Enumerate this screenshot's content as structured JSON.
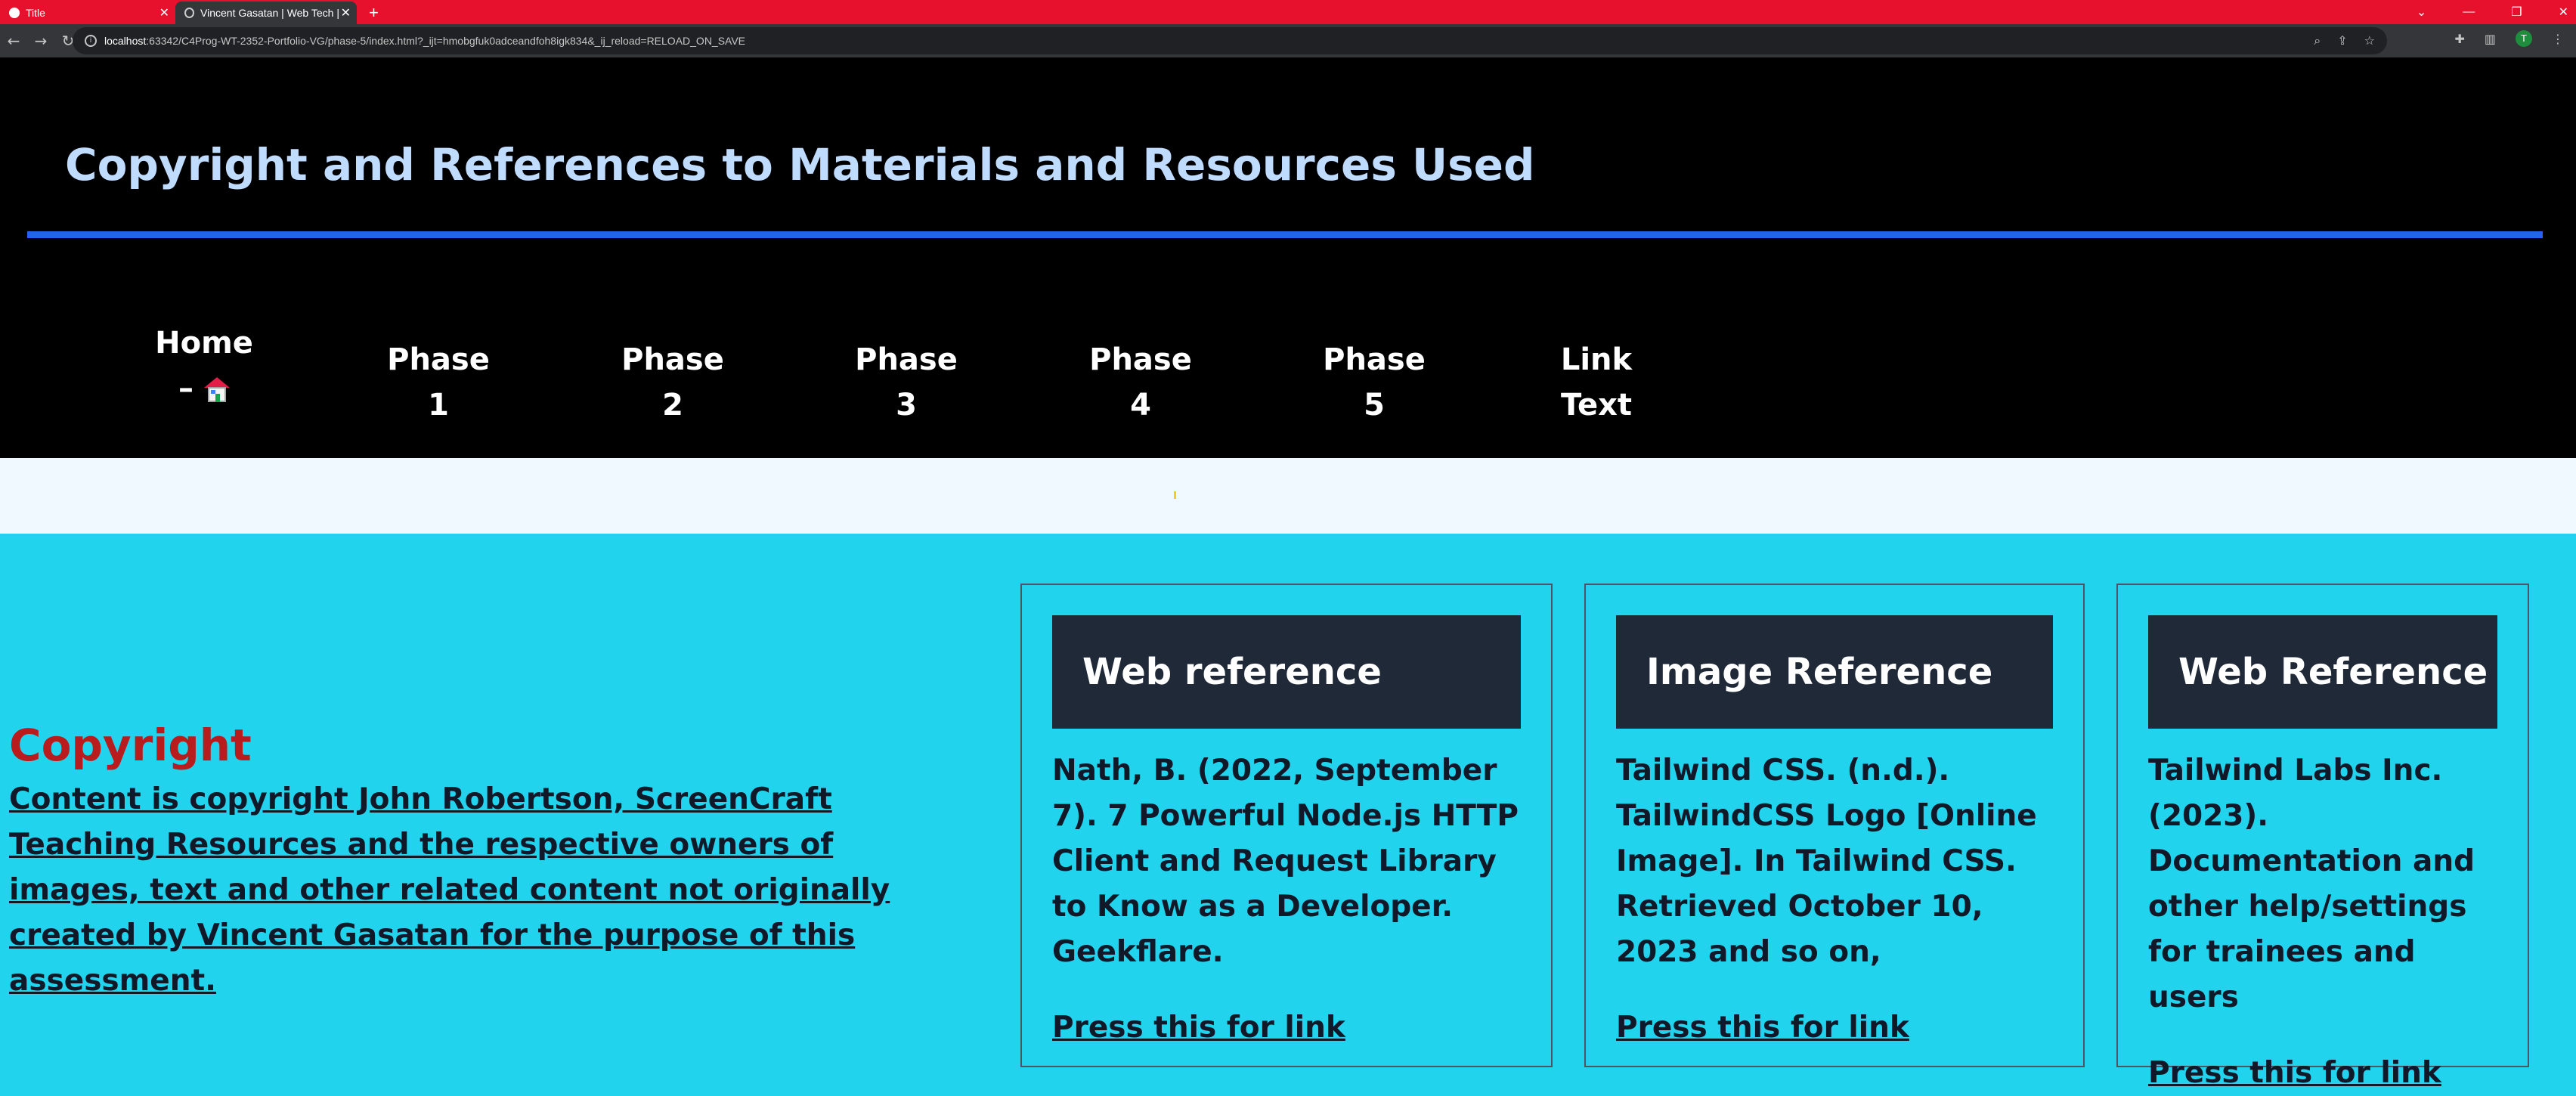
{
  "browser": {
    "tabs": [
      {
        "title": "Title"
      },
      {
        "title": "Vincent Gasatan | Web Tech | Co"
      }
    ],
    "url_host": "localhost",
    "url_rest": ":63342/C4Prog-WT-2352-Portfolio-VG/phase-5/index.html?_ijt=hmobgfuk0adceandfoh8igk834&_ij_reload=RELOAD_ON_SAVE",
    "avatar_letter": "T"
  },
  "header": {
    "title": "Copyright and References to Materials and Resources Used"
  },
  "nav": {
    "items": [
      {
        "line1": "Home",
        "line2": "– "
      },
      {
        "line1": "Phase",
        "line2": "1"
      },
      {
        "line1": "Phase",
        "line2": "2"
      },
      {
        "line1": "Phase",
        "line2": "3"
      },
      {
        "line1": "Phase",
        "line2": "4"
      },
      {
        "line1": "Phase",
        "line2": "5"
      },
      {
        "line1": "Link",
        "line2": "Text"
      }
    ]
  },
  "copyright": {
    "heading": "Copyright",
    "text": "Content is copyright John Robertson, ScreenCraft Teaching Resources and the respective owners of images, text and other related content not originally created by Vincent Gasatan for the purpose of this assessment."
  },
  "cards": [
    {
      "heading": "Web reference",
      "text": "Nath, B. (2022, September 7). 7 Powerful Node.js HTTP Client and Request Library to Know as a Developer. Geekflare.",
      "link": "Press this for link"
    },
    {
      "heading": "Image Reference",
      "text": "Tailwind CSS. (n.d.). TailwindCSS Logo [Online Image]. In Tailwind CSS. Retrieved October 10, 2023 and so on,",
      "link": "Press this for link"
    },
    {
      "heading": "Web Reference",
      "text": "Tailwind Labs Inc. (2023). Documentation and other help/settings for trainees and users",
      "link": "Press this for link"
    }
  ],
  "colors": {
    "tabbar": "#e8112d",
    "header_bg": "#000000",
    "title": "#bfdbfe",
    "rule": "#2563eb",
    "banner": "#f0f9ff",
    "content_bg": "#22d3ee",
    "copy_heading": "#b91c1c",
    "card_head": "#1f2937"
  }
}
